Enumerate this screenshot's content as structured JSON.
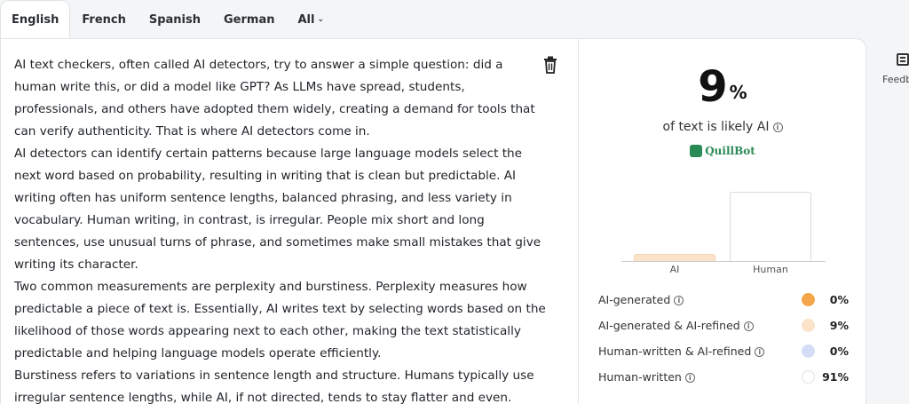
{
  "tabs": [
    {
      "label": "English",
      "active": true
    },
    {
      "label": "French"
    },
    {
      "label": "Spanish"
    },
    {
      "label": "German"
    },
    {
      "label": "All",
      "icon": "chevron-down-icon"
    }
  ],
  "editor": {
    "paragraphs": [
      "AI text checkers, often called AI detectors, try to answer a simple question: did a human write this, or did a model like GPT? As LLMs have spread, students, professionals, and others have adopted them widely, creating a demand for tools that can verify authenticity. That is where AI detectors come in.",
      "AI detectors can identify certain patterns because large language models select the next word based on probability, resulting in writing that is clean but predictable. AI writing often has uniform sentence lengths, balanced phrasing, and less variety in vocabulary. Human writing, in contrast, is irregular. People mix short and long sentences, use unusual turns of phrase, and sometimes make small mistakes that give writing its character.",
      "Two common measurements are perplexity and burstiness. Perplexity measures how predictable a piece of text is. Essentially, AI writes text by selecting words based on the likelihood of those words appearing next to each other, making the text statistically predictable and helping language models operate efficiently.",
      "Burstiness refers to variations in sentence length and structure. Humans typically use irregular sentence lengths, while AI, if not directed, tends to stay flatter and even."
    ],
    "delete_icon": "trash-icon"
  },
  "result": {
    "score": "9",
    "score_unit": "%",
    "score_label": "of text is likely AI",
    "brand": "QuillBot"
  },
  "chart_data": {
    "type": "bar",
    "categories": [
      "AI",
      "Human"
    ],
    "values": [
      9,
      91
    ],
    "ylim": [
      0,
      100
    ]
  },
  "legend": [
    {
      "label": "AI-generated",
      "value": "0%",
      "color": "#f5a54a"
    },
    {
      "label": "AI-generated & AI-refined",
      "value": "9%",
      "color": "#fbe3c9"
    },
    {
      "label": "Human-written & AI-refined",
      "value": "0%",
      "color": "#d3ddf6"
    },
    {
      "label": "Human-written",
      "value": "91%",
      "color": "#ffffff"
    }
  ],
  "sidebar": {
    "feedback_label": "Feedb"
  }
}
